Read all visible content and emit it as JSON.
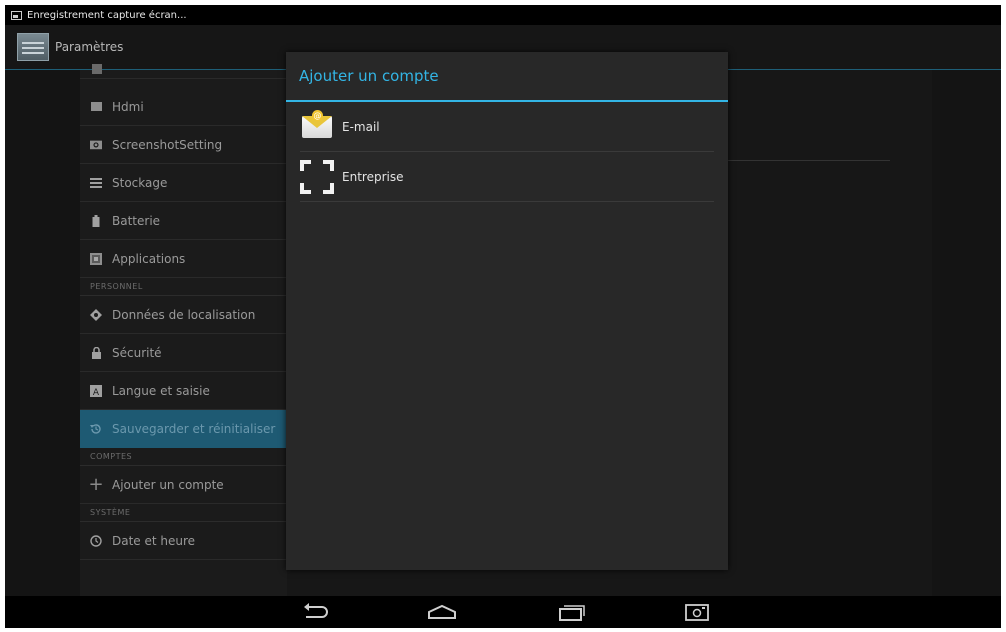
{
  "status_bar": {
    "notification_text": "Enregistrement capture écran..."
  },
  "action_bar": {
    "title": "Paramètres"
  },
  "settings": {
    "items": [
      {
        "label": "Hdmi",
        "icon": "hdmi-icon"
      },
      {
        "label": "ScreenshotSetting",
        "icon": "camera-icon"
      },
      {
        "label": "Stockage",
        "icon": "storage-icon"
      },
      {
        "label": "Batterie",
        "icon": "battery-icon"
      },
      {
        "label": "Applications",
        "icon": "apps-icon"
      }
    ],
    "header_personal": "PERSONNEL",
    "personal_items": [
      {
        "label": "Données de localisation",
        "icon": "location-icon"
      },
      {
        "label": "Sécurité",
        "icon": "lock-icon"
      },
      {
        "label": "Langue et saisie",
        "icon": "keyboard-icon"
      },
      {
        "label": "Sauvegarder et réinitialiser",
        "icon": "backup-icon"
      }
    ],
    "header_accounts": "COMPTES",
    "add_account": "Ajouter un compte",
    "header_system": "SYSTÈME",
    "date_time": "Date et heure"
  },
  "dialog": {
    "title": "Ajouter un compte",
    "options": [
      {
        "label": "E-mail",
        "icon": "email-icon"
      },
      {
        "label": "Entreprise",
        "icon": "exchange-icon"
      }
    ],
    "accent_color": "#33b5e5"
  },
  "navigation": {
    "buttons": [
      "back-icon",
      "home-icon",
      "recents-icon",
      "screenshot-icon"
    ]
  }
}
